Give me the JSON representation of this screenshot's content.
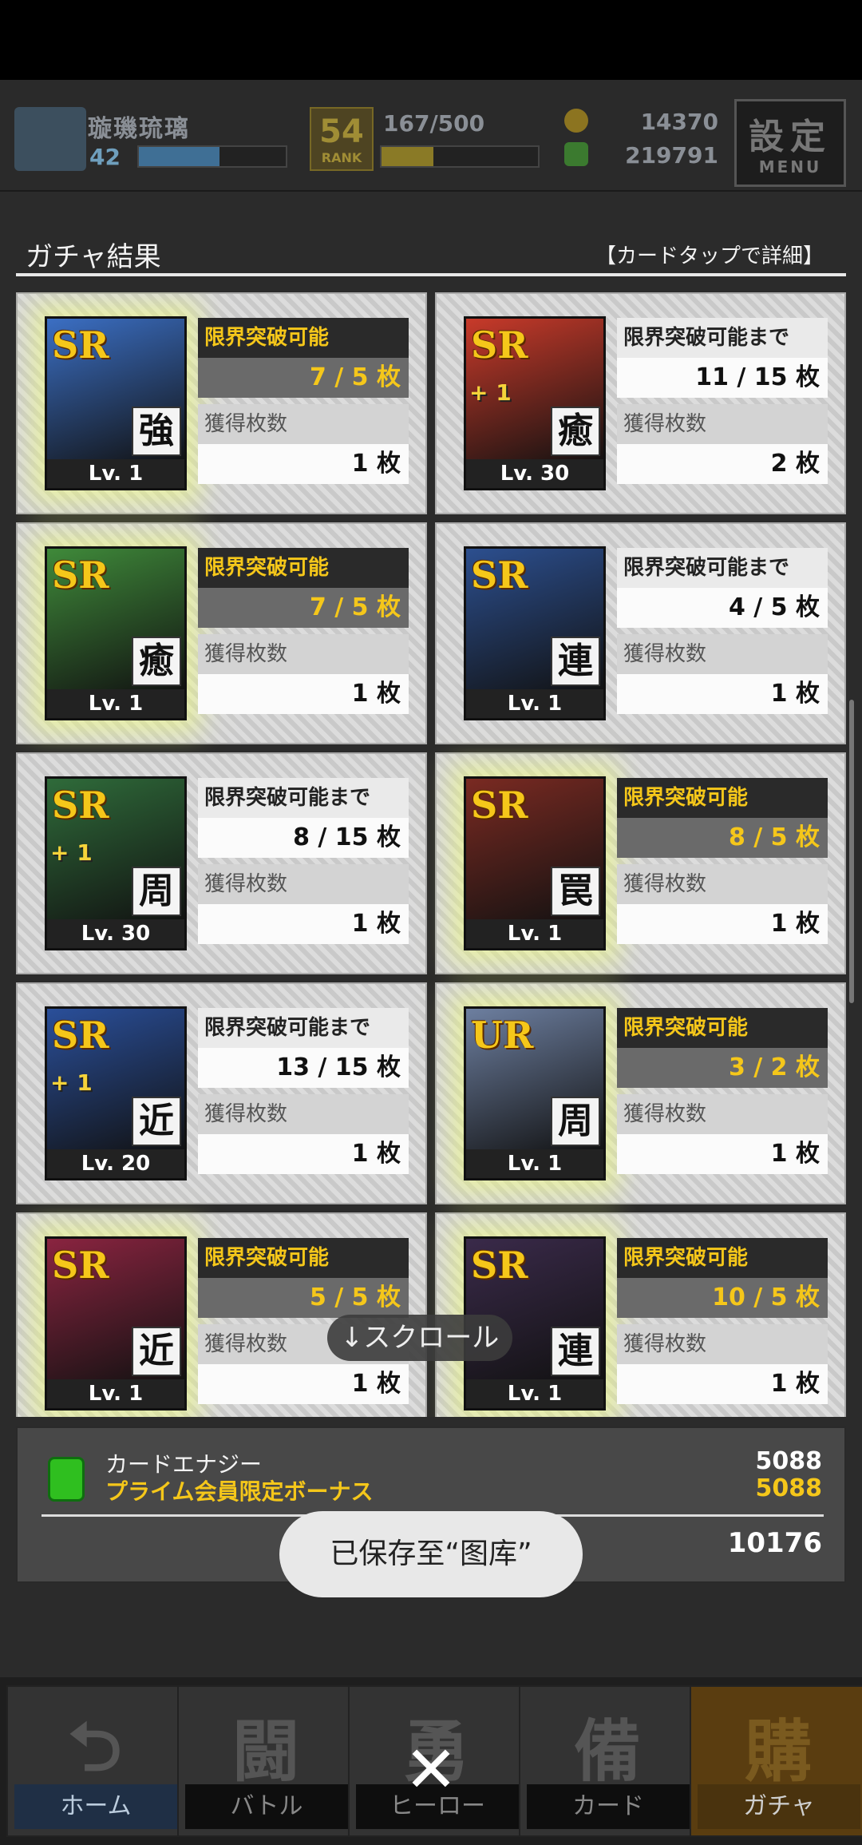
{
  "header": {
    "player_name": "璇璣琉璃",
    "player_level": "42",
    "exp_fraction": 0.55,
    "rank": "54",
    "rank_label": "RANK",
    "stamina": "167/500",
    "stamina_fraction": 0.33,
    "currency_gold": "14370",
    "currency_green": "219791",
    "menu_top": "設定",
    "menu_bottom": "MENU"
  },
  "results": {
    "title": "ガチャ結果",
    "hint": "【カードタップで詳細】",
    "cards": [
      {
        "rarity": "SR",
        "plus": "",
        "role": "強",
        "level": "Lv. 1",
        "status": "限界突破可能",
        "limit_break": true,
        "count": "7 / 5 枚",
        "acquired_label": "獲得枚数",
        "acquired": "1 枚",
        "art": "#3b6fc4"
      },
      {
        "rarity": "SR",
        "plus": "+ 1",
        "role": "癒",
        "level": "Lv. 30",
        "status": "限界突破可能まで",
        "limit_break": false,
        "count": "11 / 15 枚",
        "acquired_label": "獲得枚数",
        "acquired": "2 枚",
        "art": "#c83a2a"
      },
      {
        "rarity": "SR",
        "plus": "",
        "role": "癒",
        "level": "Lv. 1",
        "status": "限界突破可能",
        "limit_break": true,
        "count": "7 / 5 枚",
        "acquired_label": "獲得枚数",
        "acquired": "1 枚",
        "art": "#3f8a3a"
      },
      {
        "rarity": "SR",
        "plus": "",
        "role": "連",
        "level": "Lv. 1",
        "status": "限界突破可能まで",
        "limit_break": false,
        "count": "4 / 5 枚",
        "acquired_label": "獲得枚数",
        "acquired": "1 枚",
        "art": "#2c4f8f"
      },
      {
        "rarity": "SR",
        "plus": "+ 1",
        "role": "周",
        "level": "Lv. 30",
        "status": "限界突破可能まで",
        "limit_break": false,
        "count": "8 / 15 枚",
        "acquired_label": "獲得枚数",
        "acquired": "1 枚",
        "art": "#2f6b3a"
      },
      {
        "rarity": "SR",
        "plus": "",
        "role": "罠",
        "level": "Lv. 1",
        "status": "限界突破可能",
        "limit_break": true,
        "count": "8 / 5 枚",
        "acquired_label": "獲得枚数",
        "acquired": "1 枚",
        "art": "#7a2a22"
      },
      {
        "rarity": "SR",
        "plus": "+ 1",
        "role": "近",
        "level": "Lv. 20",
        "status": "限界突破可能まで",
        "limit_break": false,
        "count": "13 / 15 枚",
        "acquired_label": "獲得枚数",
        "acquired": "1 枚",
        "art": "#2a4f9a"
      },
      {
        "rarity": "UR",
        "plus": "",
        "role": "周",
        "level": "Lv. 1",
        "status": "限界突破可能",
        "limit_break": true,
        "count": "3 / 2 枚",
        "acquired_label": "獲得枚数",
        "acquired": "1 枚",
        "art": "#6d7fa0"
      },
      {
        "rarity": "SR",
        "plus": "",
        "role": "近",
        "level": "Lv. 1",
        "status": "限界突破可能",
        "limit_break": true,
        "count": "5 / 5 枚",
        "acquired_label": "獲得枚数",
        "acquired": "1 枚",
        "art": "#8a2440"
      },
      {
        "rarity": "SR",
        "plus": "",
        "role": "連",
        "level": "Lv. 1",
        "status": "限界突破可能",
        "limit_break": true,
        "count": "10 / 5 枚",
        "acquired_label": "獲得枚数",
        "acquired": "1 枚",
        "art": "#3a2a4a"
      }
    ],
    "scroll_hint": "↓スクロール"
  },
  "energy": {
    "label": "カードエナジー",
    "bonus_label": "プライム会員限定ボーナス",
    "value": "5088",
    "bonus_value": "5088",
    "total": "10176"
  },
  "toast": "已保存至“图库”",
  "nav": [
    {
      "big": "⮌",
      "label": "ホーム",
      "active": false
    },
    {
      "big": "闘",
      "label": "バトル",
      "active": false
    },
    {
      "big": "勇",
      "label": "ヒーロー",
      "active": false
    },
    {
      "big": "備",
      "label": "カード",
      "active": false
    },
    {
      "big": "購",
      "label": "ガチャ",
      "active": true
    }
  ],
  "close_glyph": "✕"
}
